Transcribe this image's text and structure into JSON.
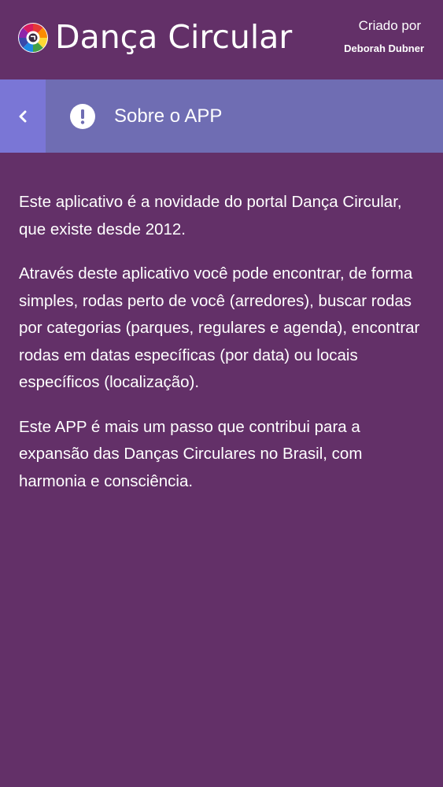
{
  "header": {
    "brand_title": "Dança Circular",
    "credit_label": "Criado por",
    "credit_name": "Deborah Dubner",
    "logo_icon": "colorful-circle-logo-icon"
  },
  "title_bar": {
    "back_icon": "chevron-left-icon",
    "alert_icon": "exclamation-circle-icon",
    "title": "Sobre o APP"
  },
  "content": {
    "paragraphs": [
      "Este aplicativo é a novidade do portal Dança Circular, que existe desde 2012.",
      "Através deste aplicativo você pode encontrar, de forma simples, rodas perto de você (arredores), buscar rodas por categorias (parques, regulares e agenda), encontrar rodas em datas específicas (por data) ou locais específicos (localização).",
      "Este APP é mais um passo que contribui para a expansão das Danças Circulares no Brasil, com harmonia e consciência."
    ]
  },
  "colors": {
    "background": "#633068",
    "title_bar": "#6f6db3",
    "back_button": "#7a76d6",
    "text": "#ffffff"
  }
}
